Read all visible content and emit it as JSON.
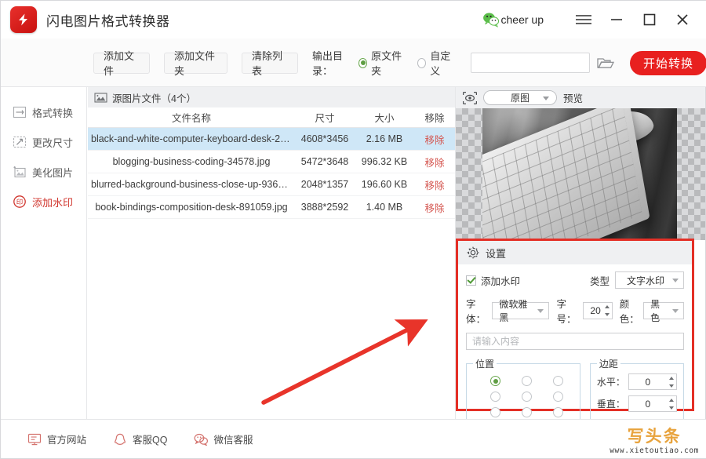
{
  "window": {
    "app_title": "闪电图片格式转换器",
    "logo_icon": "lightning-logo",
    "account": {
      "name": "cheer up",
      "icon": "wechat-icon"
    },
    "controls": {
      "menu": "☰",
      "menu_icon": "hamburger-menu-icon",
      "minimize": "—",
      "minimize_icon": "minimize-icon",
      "maximize": "☐",
      "maximize_icon": "maximize-icon",
      "close": "✕",
      "close_icon": "close-icon"
    }
  },
  "toolbar": {
    "add_file": "添加文件",
    "add_folder": "添加文件夹",
    "clear_list": "清除列表",
    "output_dir_label": "输出目录：",
    "radio_source": {
      "label": "原文件夹",
      "selected": true
    },
    "radio_custom": {
      "label": "自定义",
      "selected": false
    },
    "output_path_value": "",
    "browse_icon": "folder-open-icon",
    "start_button": "开始转换"
  },
  "sidebar": {
    "items": [
      {
        "label": "格式转换",
        "icon": "format-convert-icon",
        "active": false
      },
      {
        "label": "更改尺寸",
        "icon": "resize-icon",
        "active": false
      },
      {
        "label": "美化图片",
        "icon": "beautify-image-icon",
        "active": false
      },
      {
        "label": "添加水印",
        "icon": "watermark-seal-icon",
        "active": true
      }
    ]
  },
  "filelist": {
    "header_title": "源图片文件（4个）",
    "header_icon": "image-stack-icon",
    "columns": [
      "文件名称",
      "尺寸",
      "大小",
      "移除"
    ],
    "remove_label": "移除",
    "rows": [
      {
        "name": "black-and-white-computer-keyboard-desk-209...",
        "size": "4608*3456",
        "bytes": "2.16 MB",
        "remove": "移除",
        "selected": true
      },
      {
        "name": "blogging-business-coding-34578.jpg",
        "size": "5472*3648",
        "bytes": "996.32 KB",
        "remove": "移除",
        "selected": false
      },
      {
        "name": "blurred-background-business-close-up-936137...",
        "size": "2048*1357",
        "bytes": "196.60 KB",
        "remove": "移除",
        "selected": false
      },
      {
        "name": "book-bindings-composition-desk-891059.jpg",
        "size": "3888*2592",
        "bytes": "1.40 MB",
        "remove": "移除",
        "selected": false
      }
    ]
  },
  "preview": {
    "eye_icon": "preview-eye-icon",
    "mode_selected": "原图",
    "label": "预览"
  },
  "settings": {
    "title": "设置",
    "gear_icon": "gear-icon",
    "watermark_checkbox": {
      "label": "添加水印",
      "checked": true
    },
    "type_label": "类型",
    "type_value": "文字水印",
    "font_label": "字体：",
    "font_value": "微软雅黑",
    "fontsize_label": "字号：",
    "fontsize_value": "20",
    "color_label": "颜色：",
    "color_value": "黑色",
    "content_placeholder": "请输入内容",
    "position": {
      "legend": "位置",
      "cells": [
        true,
        false,
        false,
        false,
        false,
        false,
        false,
        false,
        false
      ]
    },
    "margin": {
      "legend": "边距",
      "horizontal_label": "水平：",
      "horizontal_value": "0",
      "vertical_label": "垂直：",
      "vertical_value": "0"
    },
    "highlight_color": "#e42f26"
  },
  "annotation": {
    "arrow_color": "#e8342a",
    "arrow_icon": "red-arrow-annotation"
  },
  "bottombar": {
    "items": [
      {
        "label": "官方网站",
        "icon": "monitor-icon"
      },
      {
        "label": "客服QQ",
        "icon": "qq-penguin-icon"
      },
      {
        "label": "微信客服",
        "icon": "wechat-icon"
      }
    ]
  },
  "watermark": {
    "brand": "写头条",
    "url": "www.xietoutiao.com"
  }
}
